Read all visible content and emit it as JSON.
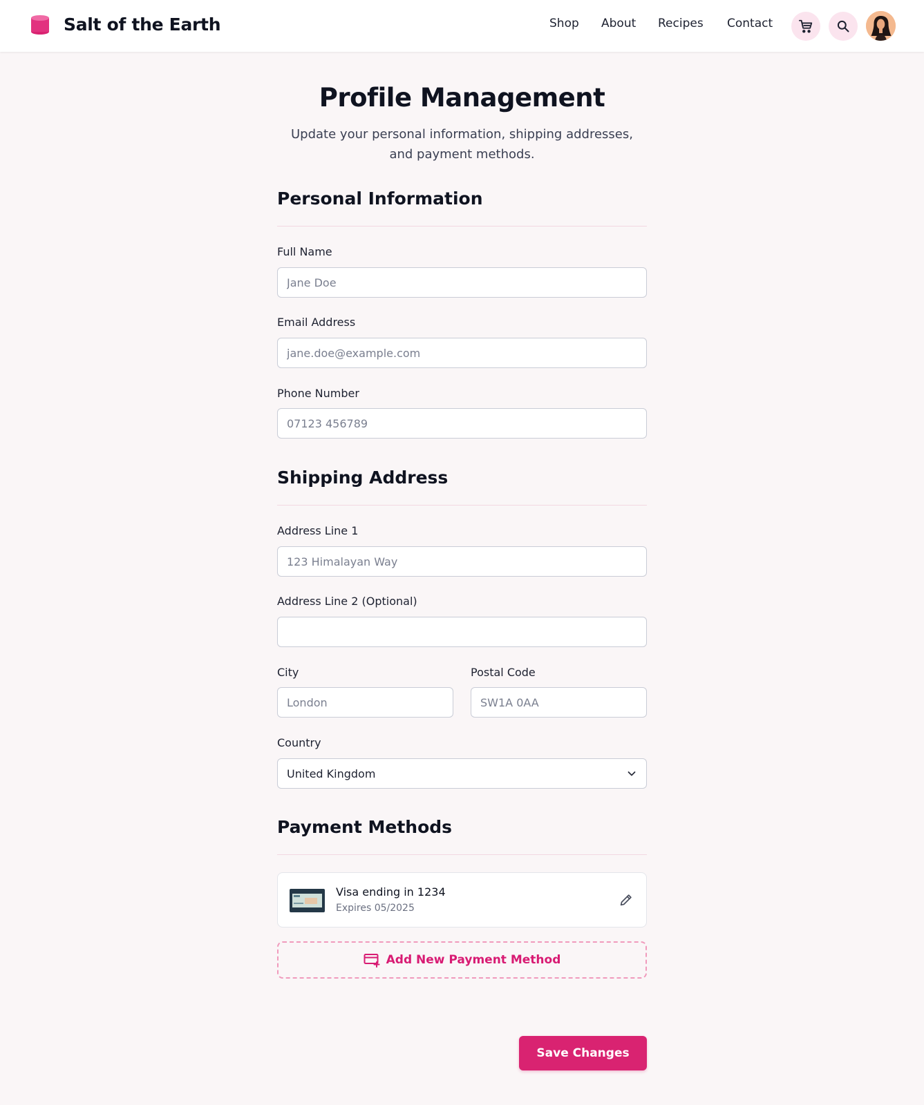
{
  "header": {
    "brand_name": "Salt of the Earth",
    "nav": [
      "Shop",
      "About",
      "Recipes",
      "Contact"
    ]
  },
  "page": {
    "title": "Profile Management",
    "subtitle_line1": "Update your personal information, shipping addresses,",
    "subtitle_line2": "and payment methods."
  },
  "personal": {
    "title": "Personal Information",
    "full_name_label": "Full Name",
    "full_name_placeholder": "Jane Doe",
    "email_label": "Email Address",
    "email_placeholder": "jane.doe@example.com",
    "phone_label": "Phone Number",
    "phone_placeholder": "07123 456789"
  },
  "shipping": {
    "title": "Shipping Address",
    "address1_label": "Address Line 1",
    "address1_placeholder": "123 Himalayan Way",
    "address2_label": "Address Line 2 (Optional)",
    "address2_placeholder": "",
    "city_label": "City",
    "city_placeholder": "London",
    "postal_label": "Postal Code",
    "postal_placeholder": "SW1A 0AA",
    "country_label": "Country",
    "country_value": "United Kingdom"
  },
  "payment": {
    "title": "Payment Methods",
    "card_title": "Visa ending in 1234",
    "card_expiry": "Expires 05/2025",
    "add_label": "Add New Payment Method"
  },
  "actions": {
    "save_label": "Save Changes"
  },
  "colors": {
    "accent": "#d92371",
    "accent_light": "#fbe4ee",
    "background": "#faf6f7"
  }
}
